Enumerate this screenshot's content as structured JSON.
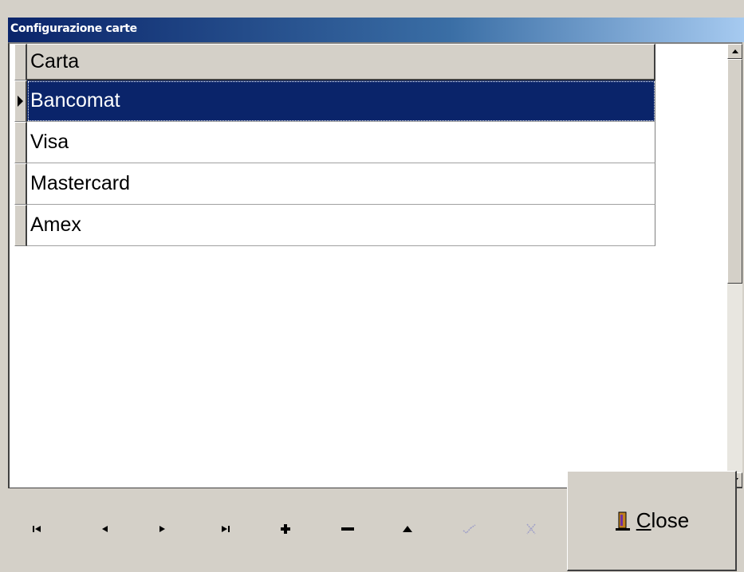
{
  "window": {
    "title": "Configurazione carte"
  },
  "grid": {
    "column_header": "Carta",
    "rows": [
      {
        "label": "Bancomat",
        "selected": true
      },
      {
        "label": "Visa",
        "selected": false
      },
      {
        "label": "Mastercard",
        "selected": false
      },
      {
        "label": "Amex",
        "selected": false
      }
    ]
  },
  "navigator": {
    "buttons": [
      {
        "name": "first-record-button",
        "icon": "first-icon",
        "enabled": true
      },
      {
        "name": "prior-record-button",
        "icon": "prior-icon",
        "enabled": true
      },
      {
        "name": "next-record-button",
        "icon": "next-icon",
        "enabled": true
      },
      {
        "name": "last-record-button",
        "icon": "last-icon",
        "enabled": true
      },
      {
        "name": "insert-record-button",
        "icon": "plus-icon",
        "enabled": true
      },
      {
        "name": "delete-record-button",
        "icon": "minus-icon",
        "enabled": true
      },
      {
        "name": "edit-record-button",
        "icon": "up-triangle-icon",
        "enabled": true
      },
      {
        "name": "post-record-button",
        "icon": "check-icon",
        "enabled": false
      },
      {
        "name": "cancel-record-button",
        "icon": "cancel-x-icon",
        "enabled": false
      }
    ]
  },
  "close_button": {
    "label": "Close",
    "icon": "exit-door-icon"
  },
  "colors": {
    "selection": "#0a246a",
    "face": "#d4d0c8",
    "title_gradient_start": "#0a246a",
    "title_gradient_end": "#a6caf0",
    "disabled_icon": "#a0a0c8"
  }
}
